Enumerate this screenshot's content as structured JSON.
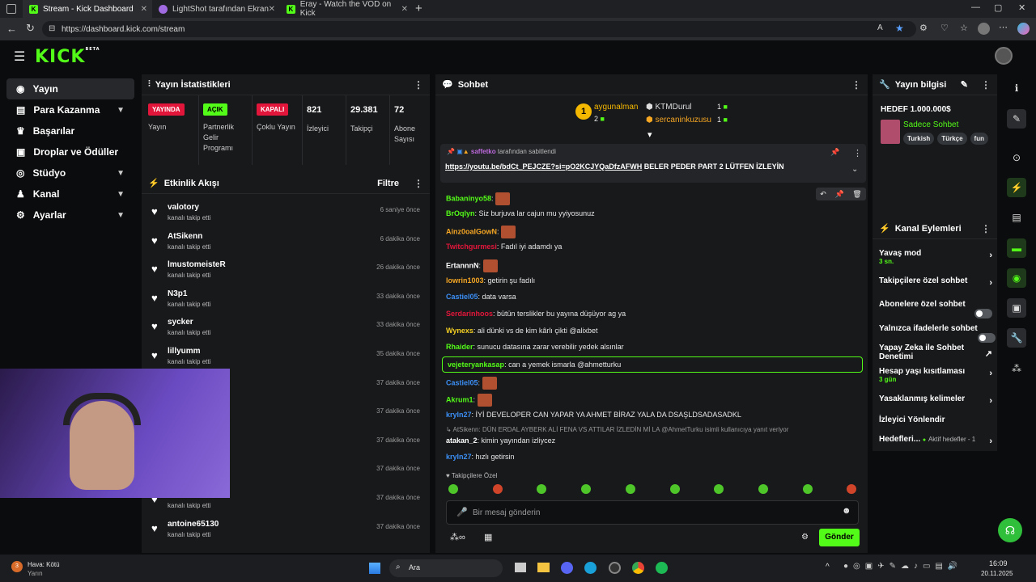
{
  "browser": {
    "tabs": [
      {
        "title": "Stream - Kick Dashboard"
      },
      {
        "title": "LightShot tarafından Ekran Görün"
      },
      {
        "title": "Eray - Watch the VOD on Kick"
      }
    ],
    "url": "https://dashboard.kick.com/stream"
  },
  "sidebar": {
    "logo": "KICK",
    "logo_sup": "BETA",
    "items": [
      {
        "label": "Yayın"
      },
      {
        "label": "Para Kazanma"
      },
      {
        "label": "Başarılar"
      },
      {
        "label": "Droplar ve Ödüller"
      },
      {
        "label": "Stüdyo"
      },
      {
        "label": "Kanal"
      },
      {
        "label": "Ayarlar"
      }
    ]
  },
  "stats": {
    "title": "Yayın İstatistikleri",
    "cells": [
      {
        "badge": "YAYINDA",
        "label": "Yayın",
        "badge_color": "#e2163a"
      },
      {
        "badge": "AÇIK",
        "label": "Partnerlik Gelir Programı",
        "badge_color": "#53fc18"
      },
      {
        "badge": "KAPALI",
        "label": "Çoklu Yayın",
        "badge_color": "#e2163a"
      },
      {
        "value": "821",
        "label": "İzleyici"
      },
      {
        "value": "29.381",
        "label": "Takipçi"
      },
      {
        "value": "72",
        "label": "Abone Sayısı"
      }
    ]
  },
  "activity": {
    "title": "Etkinlik Akışı",
    "filter": "Filtre",
    "items": [
      {
        "name": "valotory",
        "sub": "kanalı takip etti",
        "time": "6 saniye önce"
      },
      {
        "name": "AtSikenn",
        "sub": "kanalı takip etti",
        "time": "6 dakika önce"
      },
      {
        "name": "lmustomeisteR",
        "sub": "kanalı takip etti",
        "time": "26 dakika önce"
      },
      {
        "name": "N3p1",
        "sub": "kanalı takip etti",
        "time": "33 dakika önce"
      },
      {
        "name": "sycker",
        "sub": "kanalı takip etti",
        "time": "33 dakika önce"
      },
      {
        "name": "lillyumm",
        "sub": "kanalı takip etti",
        "time": "35 dakika önce"
      },
      {
        "name": "",
        "sub": "",
        "time": "37 dakika önce"
      },
      {
        "name": "",
        "sub": "",
        "time": "37 dakika önce"
      },
      {
        "name": "",
        "sub": "",
        "time": "37 dakika önce"
      },
      {
        "name": "",
        "sub": "",
        "time": "37 dakika önce"
      },
      {
        "name": "",
        "sub": "kanalı takip etti",
        "time": "37 dakika önce"
      },
      {
        "name": "antoine65130",
        "sub": "kanalı takip etti",
        "time": "37 dakika önce"
      }
    ]
  },
  "chat": {
    "title": "Sohbet",
    "top": [
      {
        "rank": "1",
        "name": "aygunalman",
        "count": "2"
      },
      {
        "name": "KTMDurul",
        "count": "1"
      },
      {
        "name": "sercaninkuzusu",
        "count": "1"
      }
    ],
    "pinned_by": "saffetko",
    "pinned_suffix": "tarafından sabitlendi",
    "pinned_link": "https://youtu.be/bdCt_PEJCZE?si=pO2KCJYQaDfzAFWH",
    "pinned_text": "BELER PEDER PART 2 LÜTFEN İZLEYİN",
    "messages": [
      {
        "user": "Babaninyo58",
        "text": "",
        "color": "#53fc18"
      },
      {
        "user": "BrOqlyn",
        "text": "Siz burjuva lar cajun mu yyiyosunuz",
        "color": "#53fc18"
      },
      {
        "user": "Ainz0oalGowN",
        "text": "",
        "color": "#f5a623"
      },
      {
        "user": "Twitchgurmesi",
        "text": "Fadıl iyi adamdı ya",
        "color": "#e2163a"
      },
      {
        "user": "ErtannnN",
        "text": "",
        "color": "#ffffff"
      },
      {
        "user": "lowrin1003",
        "text": "getirin şu fadılı",
        "color": "#f5a623"
      },
      {
        "user": "Castiel05",
        "text": "data varsa",
        "color": "#3b8ff5"
      },
      {
        "user": "Serdarinhoos",
        "text": "bütün terslikler bu yayına düşüyor ag ya",
        "color": "#e2163a"
      },
      {
        "user": "Wynexs",
        "text": "ali dünki vs de kim kârlı çikti @alixbet",
        "color": "#f5d023"
      },
      {
        "user": "Rhaider",
        "text": "sunucu datasına zarar verebilir yedek alsınlar",
        "color": "#53fc18"
      },
      {
        "user": "vejeteryankasap",
        "text": "can a yemek ismarla @ahmetturku",
        "color": "#53fc18"
      },
      {
        "user": "Castiel05",
        "text": "",
        "color": "#3b8ff5"
      },
      {
        "user": "Akrum1",
        "text": "",
        "color": "#53fc18"
      },
      {
        "user": "kryln27",
        "text": "İYİ DEVELOPER CAN YAPAR YA AHMET BİRAZ YALA DA DSAŞLDSADASADKL",
        "color": "#3b8ff5"
      },
      {
        "user": "",
        "text": "AtSikenn: DÜN ERDAL AYBERK ALİ FENA VS ATTILAR İZLEDİN Mİ LA @AhmetTurku isimli kullanıcıya yanıt veriyor",
        "color": "#888888"
      },
      {
        "user": "atakan_2",
        "text": "kimin yayından izliycez",
        "color": "#ffffff"
      },
      {
        "user": "kryln27",
        "text": "hızlı getirsin",
        "color": "#3b8ff5"
      }
    ],
    "followers_only": "Takipçilere Özel",
    "input_placeholder": "Bir mesaj gönderin",
    "send_label": "Gönder"
  },
  "info": {
    "title": "Yayın bilgisi",
    "goal": "HEDEF 1.000.000$",
    "stream_title": "Sadece Sohbet",
    "tags": [
      "Turkish",
      "Türkçe",
      "fun"
    ]
  },
  "actions": {
    "title": "Kanal Eylemleri",
    "items": [
      {
        "label": "Yavaş mod",
        "sub": "3 sn."
      },
      {
        "label": "Takipçilere özel sohbet"
      },
      {
        "label": "Abonelere özel sohbet"
      },
      {
        "label": "Yalnızca ifadelerle sohbet"
      },
      {
        "label": "Yapay Zeka ile Sohbet Denetimi"
      },
      {
        "label": "Hesap yaşı kısıtlaması",
        "sub": "3 gün"
      },
      {
        "label": "Yasaklanmış kelimeler"
      },
      {
        "label": "İzleyici Yönlendir"
      },
      {
        "label": "Hedefleri...",
        "extra": "Aktif hedefler - 1"
      }
    ]
  },
  "taskbar": {
    "weather": "Hava: Kötü",
    "weather_sub": "Yarın",
    "search": "Ara",
    "time": "16:09",
    "date": "20.11.2025",
    "weather_badge": "3"
  }
}
